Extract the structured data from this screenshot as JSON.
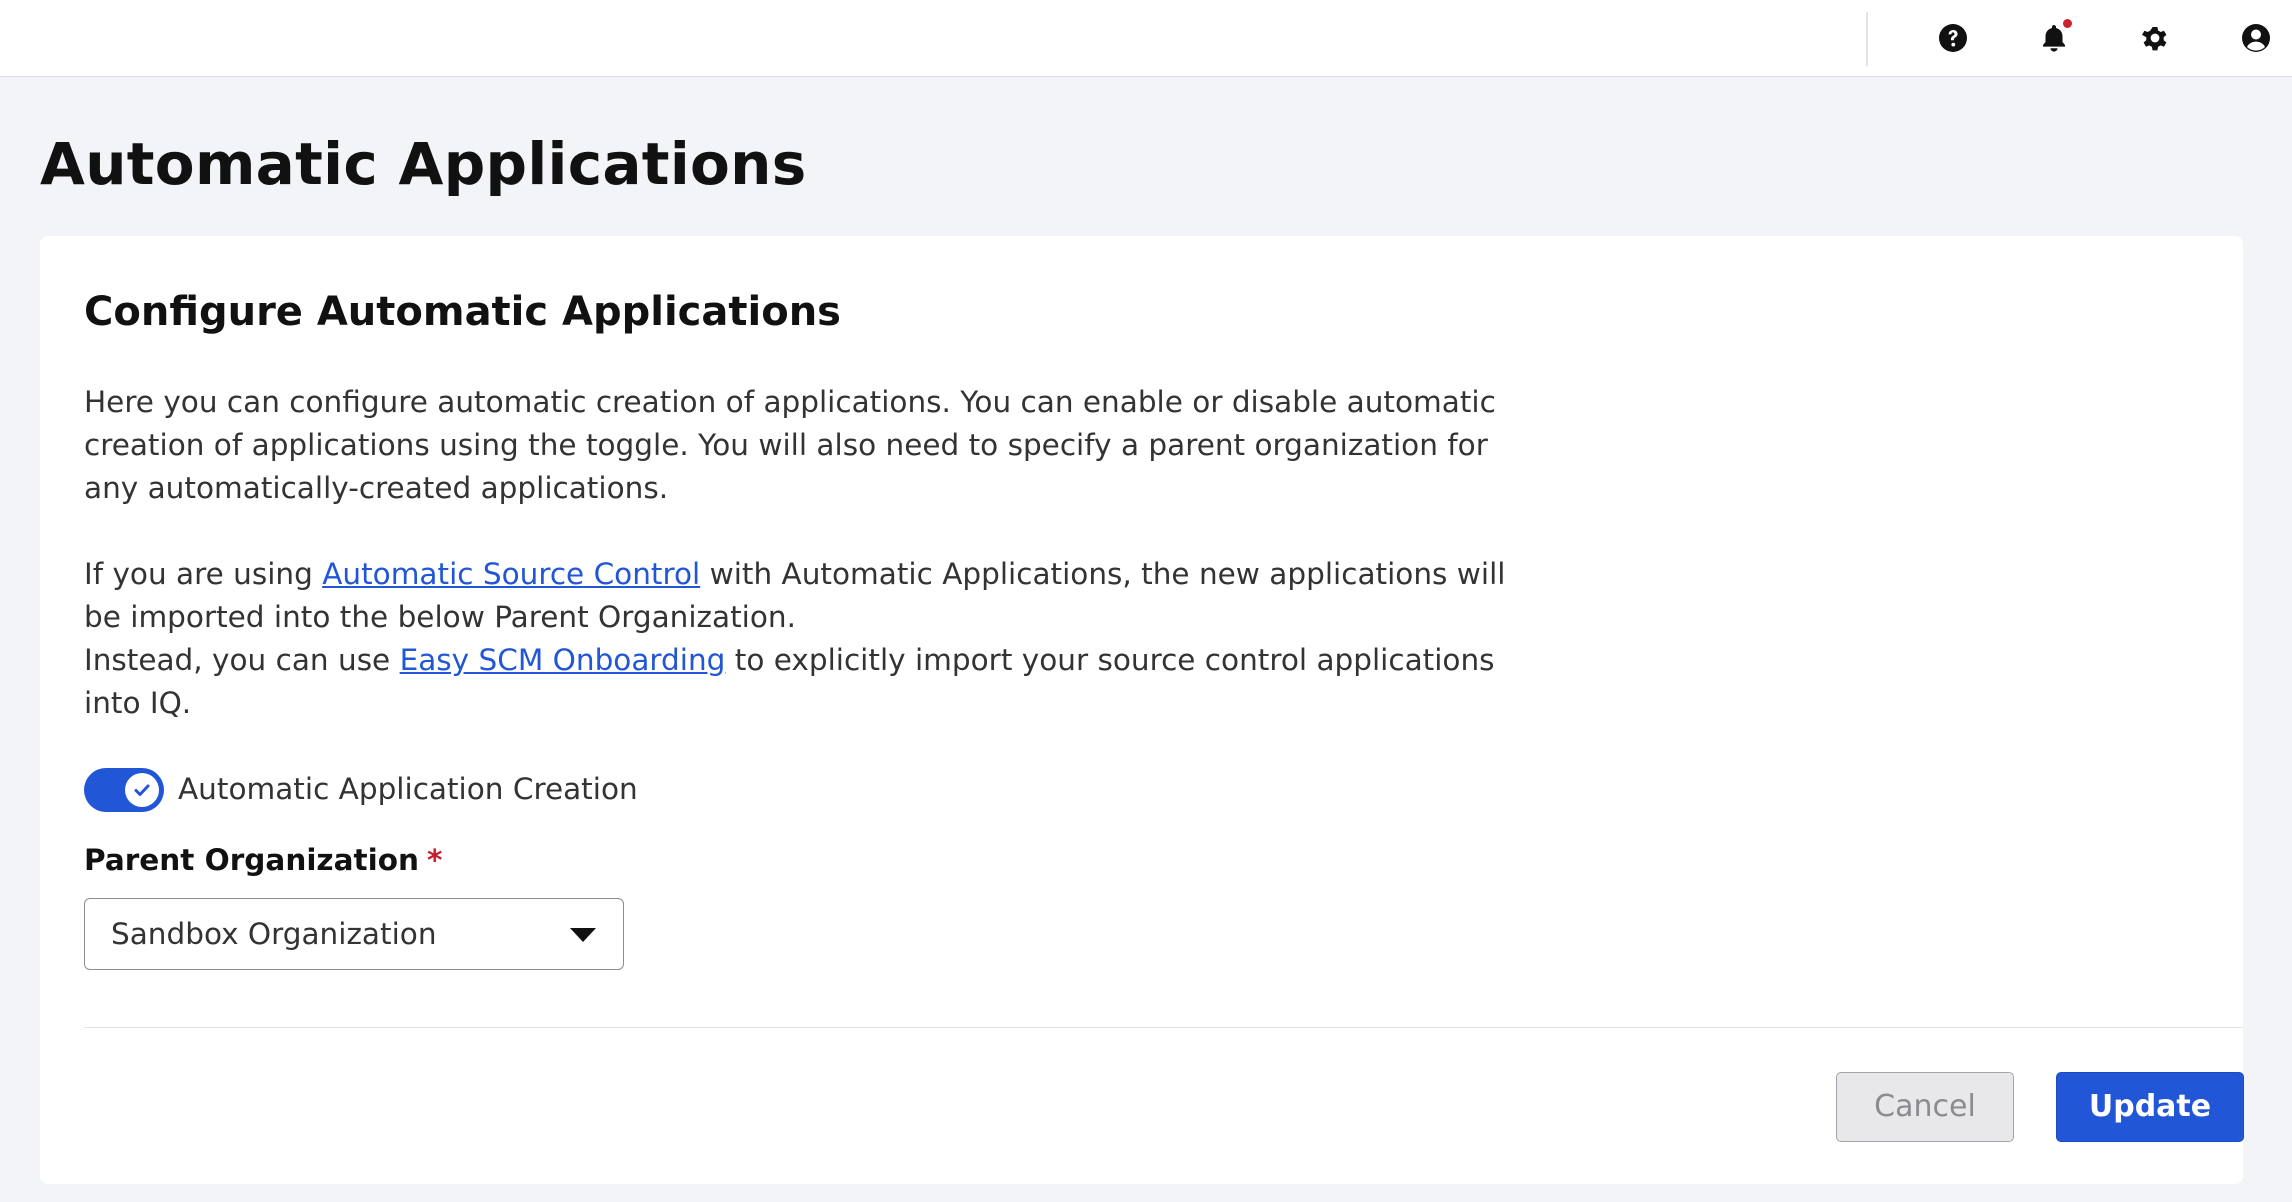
{
  "header": {
    "icons": [
      {
        "name": "help-icon"
      },
      {
        "name": "notification-bell-icon",
        "has_notification": true,
        "notification_color": "#d0202f"
      },
      {
        "name": "gear-icon"
      },
      {
        "name": "user-account-icon"
      }
    ]
  },
  "page": {
    "title": "Automatic Applications"
  },
  "card": {
    "title": "Configure Automatic Applications",
    "paragraph1": "Here you can configure automatic creation of applications. You can enable or disable automatic creation of applications using the toggle. You will also need to specify a parent organization for any automatically-created applications.",
    "paragraph2_before": "If you are using ",
    "paragraph2_link": "Automatic Source Control",
    "paragraph2_after": " with Automatic Applications, the new applications will be imported into the below Parent Organization.",
    "paragraph3_before": "Instead, you can use ",
    "paragraph3_link": "Easy SCM Onboarding",
    "paragraph3_after": " to explicitly import your source control applications into IQ.",
    "toggle": {
      "label": "Automatic Application Creation",
      "enabled": true
    },
    "parent_org": {
      "label": "Parent Organization",
      "required_marker": "*",
      "selected": "Sandbox Organization"
    },
    "buttons": {
      "cancel": "Cancel",
      "update": "Update"
    }
  },
  "colors": {
    "accent": "#2156d6",
    "required": "#c81e2c",
    "background": "#f3f4f8"
  }
}
